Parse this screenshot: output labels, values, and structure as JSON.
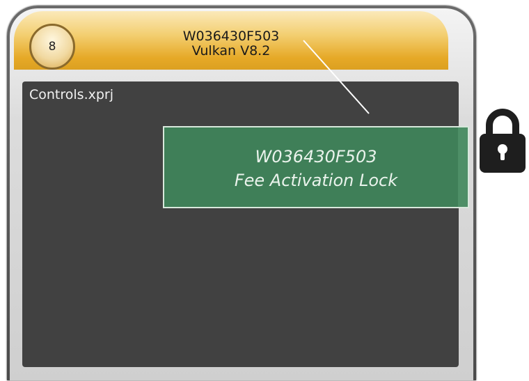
{
  "header": {
    "badge_number": "8",
    "device_id": "W036430F503",
    "version": "Vulkan V8.2"
  },
  "content": {
    "file_name": "Controls.xprj"
  },
  "notice": {
    "device_id": "W036430F503",
    "message": "Fee  Activation Lock"
  },
  "icons": {
    "lock": "lock-icon"
  },
  "colors": {
    "header_gold": "#e6a927",
    "content_bg": "#414141",
    "notice_green": "#3f7f58"
  }
}
